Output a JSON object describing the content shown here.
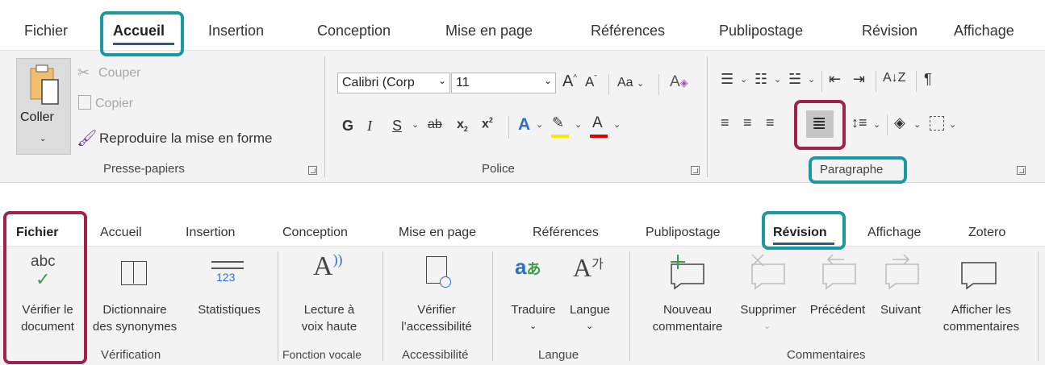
{
  "ribbon_top": {
    "tabs": [
      "Fichier",
      "Accueil",
      "Insertion",
      "Conception",
      "Mise en page",
      "Références",
      "Publipostage",
      "Révision",
      "Affichage"
    ],
    "clipboard": {
      "paste": "Coller",
      "cut": "Couper",
      "copy": "Copier",
      "format_painter": "Reproduire la mise en forme",
      "group": "Presse-papiers"
    },
    "font": {
      "font_name": "Calibri (Corp",
      "font_size": "11",
      "change_case": "Aa",
      "bold": "G",
      "italic": "I",
      "underline": "S",
      "strike": "ab",
      "group": "Police"
    },
    "paragraph": {
      "sort": "A↓Z",
      "pilcrow": "¶",
      "group": "Paragraphe"
    }
  },
  "ribbon_bottom": {
    "tabs": [
      "Fichier",
      "Accueil",
      "Insertion",
      "Conception",
      "Mise en page",
      "Références",
      "Publipostage",
      "Révision",
      "Affichage",
      "Zotero"
    ],
    "spell": {
      "icon_text": "abc",
      "line1": "Vérifier le",
      "line2": "document"
    },
    "thesaurus": {
      "line1": "Dictionnaire",
      "line2": "des synonymes"
    },
    "stats": {
      "icon_text": "123",
      "label": "Statistiques"
    },
    "read": {
      "line1": "Lecture à",
      "line2": "voix haute"
    },
    "access": {
      "line1": "Vérifier",
      "line2": "l’accessibilité"
    },
    "translate": {
      "label": "Traduire"
    },
    "language": {
      "label": "Langue"
    },
    "new_comment": {
      "line1": "Nouveau",
      "line2": "commentaire"
    },
    "delete": {
      "label": "Supprimer"
    },
    "previous": {
      "label": "Précédent"
    },
    "next": {
      "label": "Suivant"
    },
    "show_comments": {
      "line1": "Afficher les",
      "line2": "commentaires"
    },
    "groups": {
      "verification": "Vérification",
      "voice": "Fonction vocale",
      "accessibility": "Accessibilité",
      "language": "Langue",
      "comments": "Commentaires"
    }
  },
  "colors": {
    "teal": "#1a9aa0",
    "maroon": "#a0214e",
    "highlight_yellow": "#ffe600",
    "font_red": "#e00000",
    "accent_blue": "#2b579a"
  }
}
